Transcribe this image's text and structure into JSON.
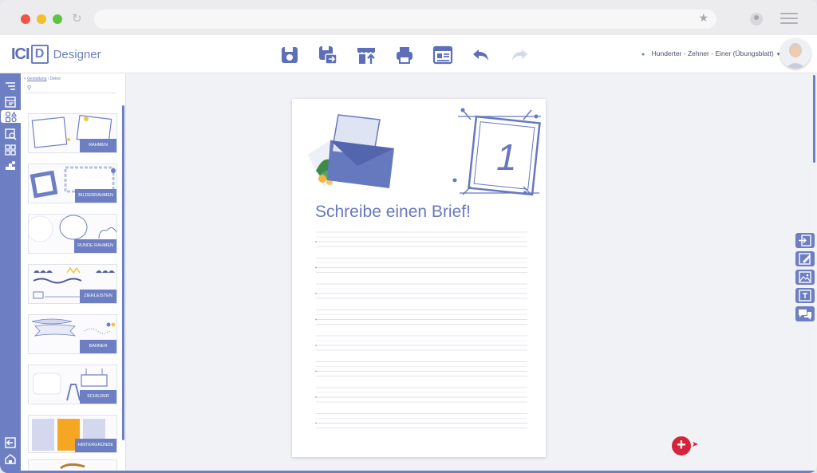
{
  "app": {
    "logo_text": "ICI",
    "logo_letter": "D",
    "logo_suffix": "Designer",
    "project_label": "Hunderter - Zehner - Einer (Übungsblatt)"
  },
  "toolbar": {
    "items": [
      "save-icon",
      "save-as-icon",
      "upload-icon",
      "print-icon",
      "preview-icon",
      "undo-icon",
      "redo-icon"
    ]
  },
  "panel": {
    "breadcrumb_link": "Gestaltung",
    "breadcrumb_current": "Dekor",
    "categories": [
      {
        "label": "RAHMEN"
      },
      {
        "label": "BILDERRAHMEN"
      },
      {
        "label": "RUNDE RAHMEN"
      },
      {
        "label": "ZIERLEISTEN"
      },
      {
        "label": "BANNER"
      },
      {
        "label": "SCHILDER"
      },
      {
        "label": "HINTERGRÜNDE"
      }
    ]
  },
  "worksheet": {
    "heading": "Schreibe einen Brief!",
    "badge_number": "1",
    "line_groups": 8
  },
  "colors": {
    "accent": "#6d7fc2",
    "danger": "#d4243a"
  }
}
